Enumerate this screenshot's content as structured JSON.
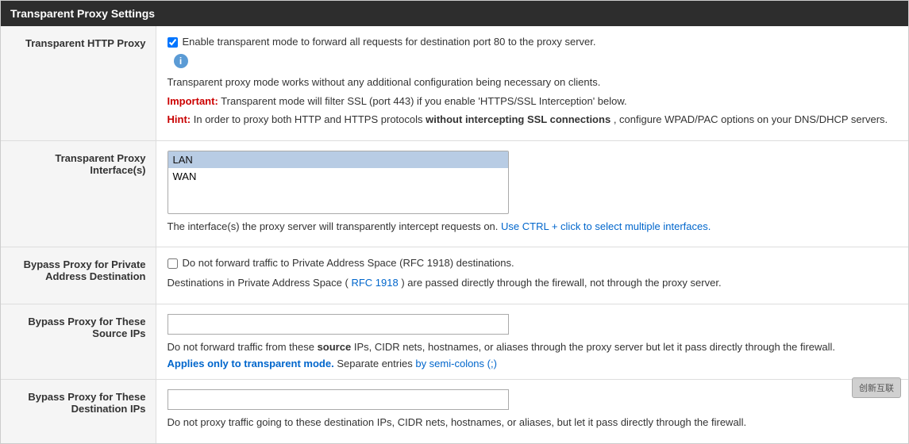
{
  "panel": {
    "title": "Transparent Proxy Settings"
  },
  "rows": [
    {
      "id": "transparent-http-proxy",
      "label": "Transparent HTTP Proxy",
      "type": "checkbox-info",
      "checkbox_label": "Enable transparent mode to forward all requests for destination port 80 to the proxy server.",
      "checked": true,
      "info_icon": "i",
      "desc1": "Transparent proxy mode works without any additional configuration being necessary on clients.",
      "important_prefix": "Important:",
      "important_text": " Transparent mode will filter SSL (port 443) if you enable 'HTTPS/SSL Interception' below.",
      "hint_prefix": "Hint:",
      "hint_text": " In order to proxy both HTTP and HTTPS protocols ",
      "hint_bold": "without intercepting SSL connections",
      "hint_suffix": ", configure WPAD/PAC options on your DNS/DHCP servers."
    },
    {
      "id": "transparent-proxy-interfaces",
      "label": "Transparent Proxy Interface(s)",
      "type": "select",
      "options": [
        "LAN",
        "WAN"
      ],
      "selected": "LAN",
      "desc": "The interface(s) the proxy server will transparently intercept requests on.",
      "link_text": "Use CTRL + click to select multiple interfaces.",
      "link_href": "#"
    },
    {
      "id": "bypass-private",
      "label": "Bypass Proxy for Private Address Destination",
      "type": "checkbox",
      "checked": false,
      "checkbox_label": "Do not forward traffic to Private Address Space (RFC 1918) destinations.",
      "desc_prefix": "Destinations in Private Address Space (",
      "desc_link": "RFC 1918",
      "desc_suffix": ") are passed directly through the firewall, not through the proxy server."
    },
    {
      "id": "bypass-source-ips",
      "label": "Bypass Proxy for These Source IPs",
      "type": "input",
      "input_value": "",
      "desc": "Do not forward traffic from these ",
      "desc_bold": "source",
      "desc2": " IPs, CIDR nets, hostnames, or aliases through the proxy server but let it pass directly through the firewall.",
      "applies_text": "Applies only to transparent mode.",
      "separate_text": " Separate entries ",
      "by_text": "by semi-colons (;)"
    },
    {
      "id": "bypass-dest-ips",
      "label": "Bypass Proxy for These Destination IPs",
      "type": "input",
      "input_value": "",
      "desc": "Do not proxy traffic going to these destination IPs, CIDR nets, hostnames, or aliases, but let it pass directly through the firewall."
    }
  ]
}
